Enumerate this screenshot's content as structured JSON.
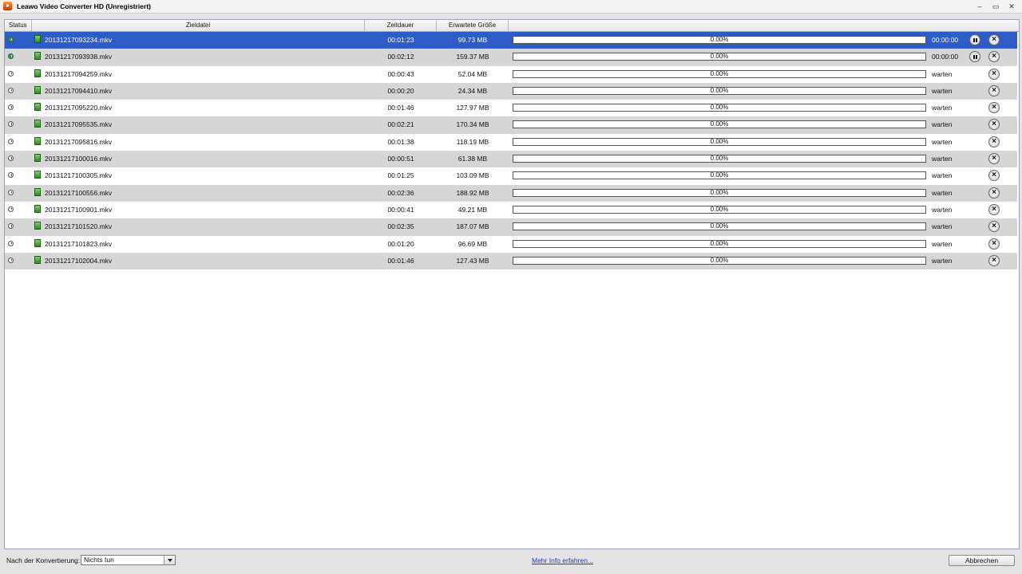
{
  "window": {
    "title": "Leawo Video Converter HD (Unregistriert)",
    "controls": [
      "–",
      "▭",
      "✕"
    ]
  },
  "table": {
    "headers": {
      "status": "Status",
      "zieldatei": "Zieldatei",
      "zeitdauer": "Zeitdauer",
      "groesse": "Erwartete Größe"
    },
    "rows": [
      {
        "file": "20131217093234.mkv",
        "duration": "00:01:23",
        "size": "99.73 MB",
        "progress_text": "0.00%",
        "progress_fraction": 0,
        "state_text": "00:00:00",
        "active": true,
        "selected": true
      },
      {
        "file": "20131217093938.mkv",
        "duration": "00:02:12",
        "size": "159.37 MB",
        "progress_text": "0.00%",
        "progress_fraction": 0,
        "state_text": "00:00:00",
        "active": true,
        "selected": false
      },
      {
        "file": "20131217094259.mkv",
        "duration": "00:00:43",
        "size": "52.04 MB",
        "progress_text": "0.00%",
        "progress_fraction": 0,
        "state_text": "warten",
        "active": false,
        "selected": false
      },
      {
        "file": "20131217094410.mkv",
        "duration": "00:00:20",
        "size": "24.34 MB",
        "progress_text": "0.00%",
        "progress_fraction": 0,
        "state_text": "warten",
        "active": false,
        "selected": false
      },
      {
        "file": "20131217095220.mkv",
        "duration": "00:01:46",
        "size": "127.97 MB",
        "progress_text": "0.00%",
        "progress_fraction": 0,
        "state_text": "warten",
        "active": false,
        "selected": false
      },
      {
        "file": "20131217095535.mkv",
        "duration": "00:02:21",
        "size": "170.34 MB",
        "progress_text": "0.00%",
        "progress_fraction": 0,
        "state_text": "warten",
        "active": false,
        "selected": false
      },
      {
        "file": "20131217095816.mkv",
        "duration": "00:01:38",
        "size": "118.19 MB",
        "progress_text": "0.00%",
        "progress_fraction": 0,
        "state_text": "warten",
        "active": false,
        "selected": false
      },
      {
        "file": "20131217100016.mkv",
        "duration": "00:00:51",
        "size": "61.38 MB",
        "progress_text": "0.00%",
        "progress_fraction": 0,
        "state_text": "warten",
        "active": false,
        "selected": false
      },
      {
        "file": "20131217100305.mkv",
        "duration": "00:01:25",
        "size": "103.09 MB",
        "progress_text": "0.00%",
        "progress_fraction": 0,
        "state_text": "warten",
        "active": false,
        "selected": false
      },
      {
        "file": "20131217100556.mkv",
        "duration": "00:02:36",
        "size": "188.92 MB",
        "progress_text": "0.00%",
        "progress_fraction": 0,
        "state_text": "warten",
        "active": false,
        "selected": false
      },
      {
        "file": "20131217100901.mkv",
        "duration": "00:00:41",
        "size": "49.21 MB",
        "progress_text": "0.00%",
        "progress_fraction": 0,
        "state_text": "warten",
        "active": false,
        "selected": false
      },
      {
        "file": "20131217101520.mkv",
        "duration": "00:02:35",
        "size": "187.07 MB",
        "progress_text": "0.00%",
        "progress_fraction": 0,
        "state_text": "warten",
        "active": false,
        "selected": false
      },
      {
        "file": "20131217101823.mkv",
        "duration": "00:01:20",
        "size": "96.69 MB",
        "progress_text": "0.00%",
        "progress_fraction": 0,
        "state_text": "warten",
        "active": false,
        "selected": false
      },
      {
        "file": "20131217102004.mkv",
        "duration": "00:01:46",
        "size": "127.43 MB",
        "progress_text": "0.00%",
        "progress_fraction": 0,
        "state_text": "warten",
        "active": false,
        "selected": false
      }
    ]
  },
  "footer": {
    "after_label": "Nach der Konvertierung:",
    "after_value": "Nichts tun",
    "more_info": "Mehr Info erfahren...",
    "cancel": "Abbrechen"
  },
  "colors": {
    "selected_row": "#2e5bc5",
    "alt_row": "#d6d6d6",
    "link": "#1a3fb5"
  },
  "icons": {
    "app": "leawo-app-icon",
    "status_active": "converting-status-icon",
    "status_waiting": "clock-icon",
    "file": "video-file-icon",
    "pause": "pause-icon",
    "cancel": "close-icon"
  }
}
